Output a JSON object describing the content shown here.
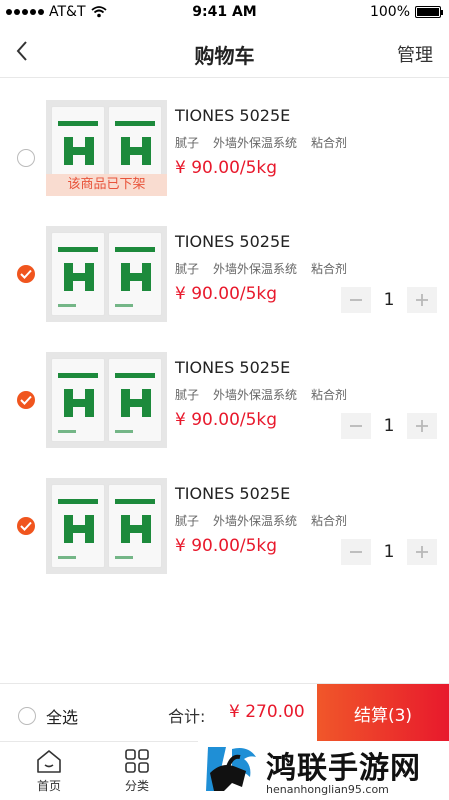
{
  "status_bar": {
    "carrier": "AT&T",
    "time": "9:41 AM",
    "battery": "100%"
  },
  "nav": {
    "title": "购物车",
    "manage": "管理"
  },
  "items": [
    {
      "name": "TIONES 5025E",
      "tags": [
        "腻子",
        "外墙外保温系统",
        "粘合剂"
      ],
      "price": "¥ 90.00/5kg",
      "checked": false,
      "off_shelf": "该商品已下架"
    },
    {
      "name": "TIONES 5025E",
      "tags": [
        "腻子",
        "外墙外保温系统",
        "粘合剂"
      ],
      "price": "¥ 90.00/5kg",
      "checked": true,
      "quantity": "1"
    },
    {
      "name": "TIONES 5025E",
      "tags": [
        "腻子",
        "外墙外保温系统",
        "粘合剂"
      ],
      "price": "¥ 90.00/5kg",
      "checked": true,
      "quantity": "1"
    },
    {
      "name": "TIONES 5025E",
      "tags": [
        "腻子",
        "外墙外保温系统",
        "粘合剂"
      ],
      "price": "¥ 90.00/5kg",
      "checked": true,
      "quantity": "1"
    }
  ],
  "footer": {
    "select_all": "全选",
    "total_label": "合计:",
    "total_value": "¥ 270.00",
    "checkout": "结算(3)"
  },
  "tabs": [
    {
      "label": "首页",
      "icon": "home-icon"
    },
    {
      "label": "分类",
      "icon": "grid-icon"
    }
  ],
  "watermark": {
    "title": "鸿联手游网",
    "url": "henanhonglian95.com"
  },
  "colors": {
    "accent": "#f0551e",
    "price": "#e8192c",
    "product_green": "#1d8a3c"
  }
}
